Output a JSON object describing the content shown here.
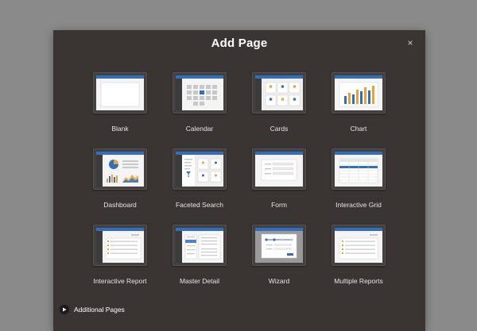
{
  "dialog": {
    "title": "Add Page",
    "close_glyph": "×",
    "additional_pages_label": "Additional Pages"
  },
  "tiles": [
    {
      "label": "Blank",
      "icon": "blank-page-icon"
    },
    {
      "label": "Calendar",
      "icon": "calendar-page-icon"
    },
    {
      "label": "Cards",
      "icon": "cards-page-icon"
    },
    {
      "label": "Chart",
      "icon": "chart-page-icon"
    },
    {
      "label": "Dashboard",
      "icon": "dashboard-page-icon"
    },
    {
      "label": "Faceted Search",
      "icon": "faceted-search-page-icon"
    },
    {
      "label": "Form",
      "icon": "form-page-icon"
    },
    {
      "label": "Interactive Grid",
      "icon": "interactive-grid-page-icon"
    },
    {
      "label": "Interactive Report",
      "icon": "interactive-report-page-icon"
    },
    {
      "label": "Master Detail",
      "icon": "master-detail-page-icon"
    },
    {
      "label": "Wizard",
      "icon": "wizard-page-icon"
    },
    {
      "label": "Multiple Reports",
      "icon": "multiple-reports-page-icon"
    }
  ],
  "colors": {
    "dialog_bg": "#3a3432",
    "backdrop": "#8a8a8a",
    "accent_blue": "#2e6fbf",
    "accent_orange": "#f0a030"
  }
}
